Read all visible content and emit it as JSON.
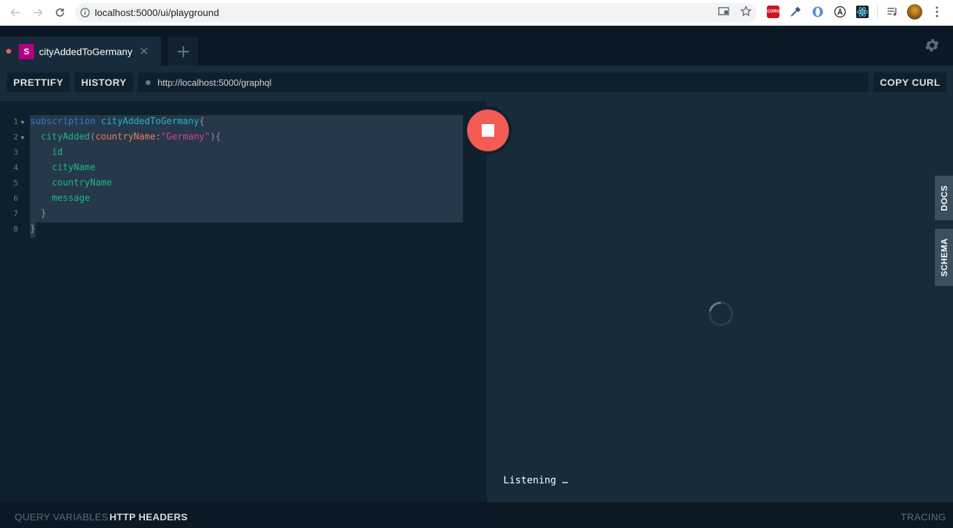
{
  "browser": {
    "url": "localhost:5000/ui/playground",
    "extensions": [
      "cors-icon",
      "eyedropper-icon",
      "circle-icon",
      "a-icon",
      "react-icon",
      "playlist-icon",
      "avatar"
    ]
  },
  "tabs": [
    {
      "badge": "S",
      "title": "cityAddedToGermany",
      "active": true
    }
  ],
  "toolbar": {
    "prettify_label": "PRETTIFY",
    "history_label": "HISTORY",
    "endpoint": "http://localhost:5000/graphql",
    "copy_curl_label": "COPY CURL"
  },
  "editor": {
    "line_numbers": [
      "1",
      "2",
      "3",
      "4",
      "5",
      "6",
      "7",
      "8"
    ],
    "lines": {
      "l1": {
        "kw": "subscription",
        "name": "cityAddedToGermany",
        "brace": "{"
      },
      "l2": {
        "field": "cityAdded",
        "open": "(",
        "arg": "countryName",
        "colon": ":",
        "str": "\"Germany\"",
        "close": "){"
      },
      "l3": "id",
      "l4": "cityName",
      "l5": "countryName",
      "l6": "message",
      "l7": "}",
      "l8": "}"
    }
  },
  "result": {
    "status_text": "Listening …"
  },
  "side_tabs": {
    "docs": "DOCS",
    "schema": "SCHEMA"
  },
  "bottom": {
    "query_variables": "QUERY VARIABLES",
    "http_headers": "HTTP HEADERS",
    "tracing": "TRACING"
  },
  "colors": {
    "accent_red": "#f25c54",
    "badge_magenta": "#b10084",
    "editor_bg": "#0f202d",
    "panel_bg": "#172b3a"
  }
}
